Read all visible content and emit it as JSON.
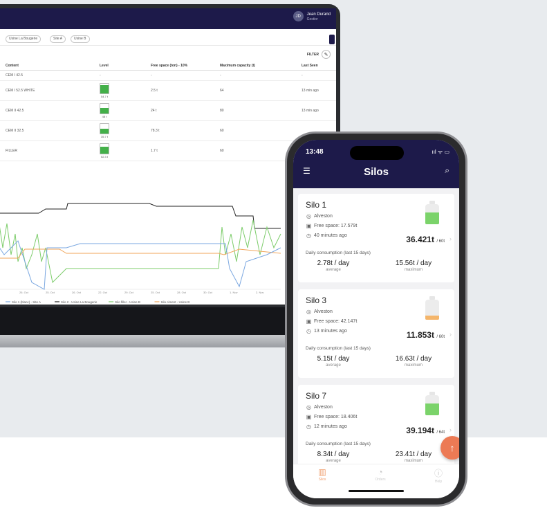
{
  "laptop": {
    "user": {
      "initials": "JD",
      "name": "Jean Durand",
      "role": "Gestior"
    },
    "chips": [
      "Usine La Bougerie",
      "Site A",
      "Usine B"
    ],
    "filter_label": "FILTER",
    "table": {
      "headers": [
        "Content",
        "Level",
        "Free space (ton) - 10%",
        "Maximum capacity (t)",
        "Last Seen"
      ],
      "rows": [
        {
          "content": "CEM I 42.5",
          "level": null,
          "level_label": "-",
          "free": "-",
          "max": "-",
          "last": "-"
        },
        {
          "content": "CEM I 52.5 WHITE",
          "level": 0.85,
          "level_label": "54.7 t",
          "free": "2.5 t",
          "max": "64",
          "last": "13 min ago"
        },
        {
          "content": "CEM II 42.5",
          "level": 0.6,
          "level_label": "48 t",
          "free": "24 t",
          "max": "80",
          "last": "13 min ago"
        },
        {
          "content": "CEM II 32.5",
          "level": 0.5,
          "level_label": "35.7 t",
          "free": "78.3 t",
          "max": "60",
          "last": ""
        },
        {
          "content": "FILLER",
          "level": 0.7,
          "level_label": "52.3 t",
          "free": "1.7 t",
          "max": "60",
          "last": ""
        }
      ]
    },
    "chart_dates": [
      "Oct",
      "26. Oct",
      "25. Oct",
      "26. Oct",
      "22. Oct",
      "29. Oct",
      "25. Oct",
      "28. Oct",
      "30. Oct",
      "1. Nov",
      "2. Nov"
    ],
    "legend": [
      {
        "name": "Silo 1 (blanc) - Site A",
        "color": "#7aa7e0"
      },
      {
        "name": "Silo 2 - Usine La Bougerie",
        "color": "#222222"
      },
      {
        "name": "Silo filler - Usine B",
        "color": "#7ccc6a"
      },
      {
        "name": "Silo ciment - Usine B",
        "color": "#f0a55a"
      }
    ]
  },
  "phone": {
    "time": "13:48",
    "status": "ııl ᯤ ▭",
    "title": "Silos",
    "cards": [
      {
        "name": "Silo 1",
        "location": "Alveston",
        "free_space": "Free space: 17.579t",
        "last_seen": "40 minutes ago",
        "amount": "36.421t",
        "capacity": "/ 60t",
        "daily_label": "Daily consumption (last 15 days)",
        "avg_val": "2.78t / day",
        "avg_lbl": "average",
        "max_val": "15.56t / day",
        "max_lbl": "maximum",
        "level": 0.6,
        "fill_color": "#7bd36a"
      },
      {
        "name": "Silo 3",
        "location": "Alveston",
        "free_space": "Free space: 42.147t",
        "last_seen": "13 minutes ago",
        "amount": "11.853t",
        "capacity": "/ 60t",
        "daily_label": "Daily consumption (last 15 days)",
        "avg_val": "5.15t / day",
        "avg_lbl": "average",
        "max_val": "16.63t / day",
        "max_lbl": "maximum",
        "level": 0.2,
        "fill_color": "#f4b56a"
      },
      {
        "name": "Silo 7",
        "location": "Alveston",
        "free_space": "Free space: 18.406t",
        "last_seen": "12 minutes ago",
        "amount": "39.194t",
        "capacity": "/ 64t",
        "daily_label": "Daily consumption (last 15 days)",
        "avg_val": "8.34t / day",
        "avg_lbl": "average",
        "max_val": "23.41t / day",
        "max_lbl": "maximum",
        "level": 0.6,
        "fill_color": "#7bd36a"
      }
    ],
    "tabs": [
      {
        "label": "Silos",
        "icon": "▥",
        "active": true
      },
      {
        "label": "Orders",
        "icon": "◔",
        "active": false
      },
      {
        "label": "Help",
        "icon": "ⓘ",
        "active": false
      }
    ],
    "fab_icon": "↑"
  }
}
